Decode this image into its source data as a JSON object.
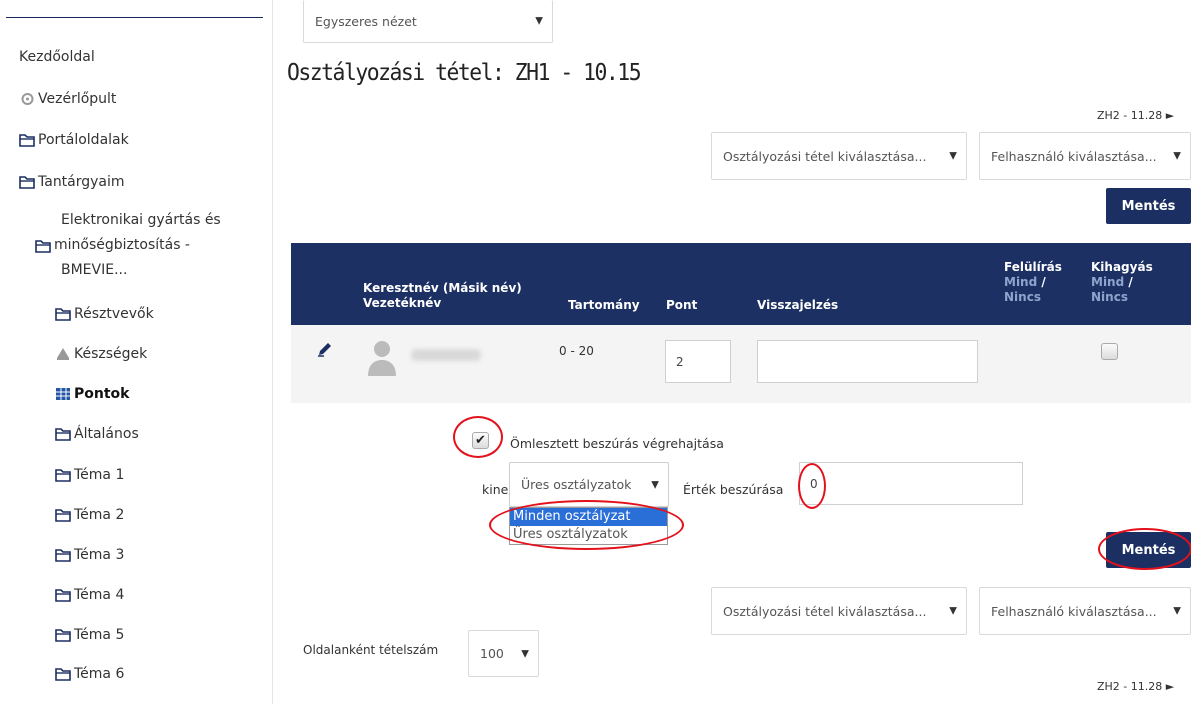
{
  "sidebar": {
    "home": "Kezdőoldal",
    "dashboard": "Vezérlőpult",
    "portal_pages": "Portáloldalak",
    "my_courses": "Tantárgyaim",
    "course_line1": "Elektronikai gyártás és",
    "course_line2": "minőségbiztosítás -",
    "course_line3": "BMEVIE...",
    "items": [
      {
        "label": "Résztvevők",
        "icon": "folder-icon"
      },
      {
        "label": "Készségek",
        "icon": "competency-icon"
      },
      {
        "label": "Pontok",
        "icon": "grades-table-icon"
      },
      {
        "label": "Általános",
        "icon": "folder-icon"
      },
      {
        "label": "Téma 1",
        "icon": "folder-icon"
      },
      {
        "label": "Téma 2",
        "icon": "folder-icon"
      },
      {
        "label": "Téma 3",
        "icon": "folder-icon"
      },
      {
        "label": "Téma 4",
        "icon": "folder-icon"
      },
      {
        "label": "Téma 5",
        "icon": "folder-icon"
      },
      {
        "label": "Téma 6",
        "icon": "folder-icon"
      }
    ]
  },
  "view_select": "Egyszeres nézet",
  "title": "Osztályozási tétel: ZH1 - 10.15",
  "next_link": "ZH2 - 11.28 ►",
  "grade_item_select": "Osztályozási tétel kiválasztása...",
  "user_select": "Felhasználó kiválasztása...",
  "save_label": "Mentés",
  "table": {
    "col_name_line1": "Keresztnév (Másik név)",
    "col_name_line2": "Vezetéknév",
    "col_range": "Tartomány",
    "col_points": "Pont",
    "col_feedback": "Visszajelzés",
    "col_override": "Felülírás",
    "col_exclude": "Kihagyás",
    "sub_all": "Mind",
    "sub_sep": " /",
    "sub_none": "Nincs",
    "row": {
      "range": "0 - 20",
      "points": "2",
      "feedback": ""
    }
  },
  "bulk": {
    "checkbox_label": "Ömlesztett beszúrás végrehajtása",
    "for_label": "kinek",
    "apply_select": "Üres osztályzatok",
    "options": [
      "Minden osztályzat",
      "Üres osztályzatok"
    ],
    "insert_label": "Érték beszúrása",
    "insert_value": "0"
  },
  "per_page_label": "Oldalanként tételszám",
  "per_page_value": "100",
  "colors": {
    "navy": "#1d3063",
    "annotation_red": "#e3111b",
    "selected_option": "#2a6ed8"
  }
}
